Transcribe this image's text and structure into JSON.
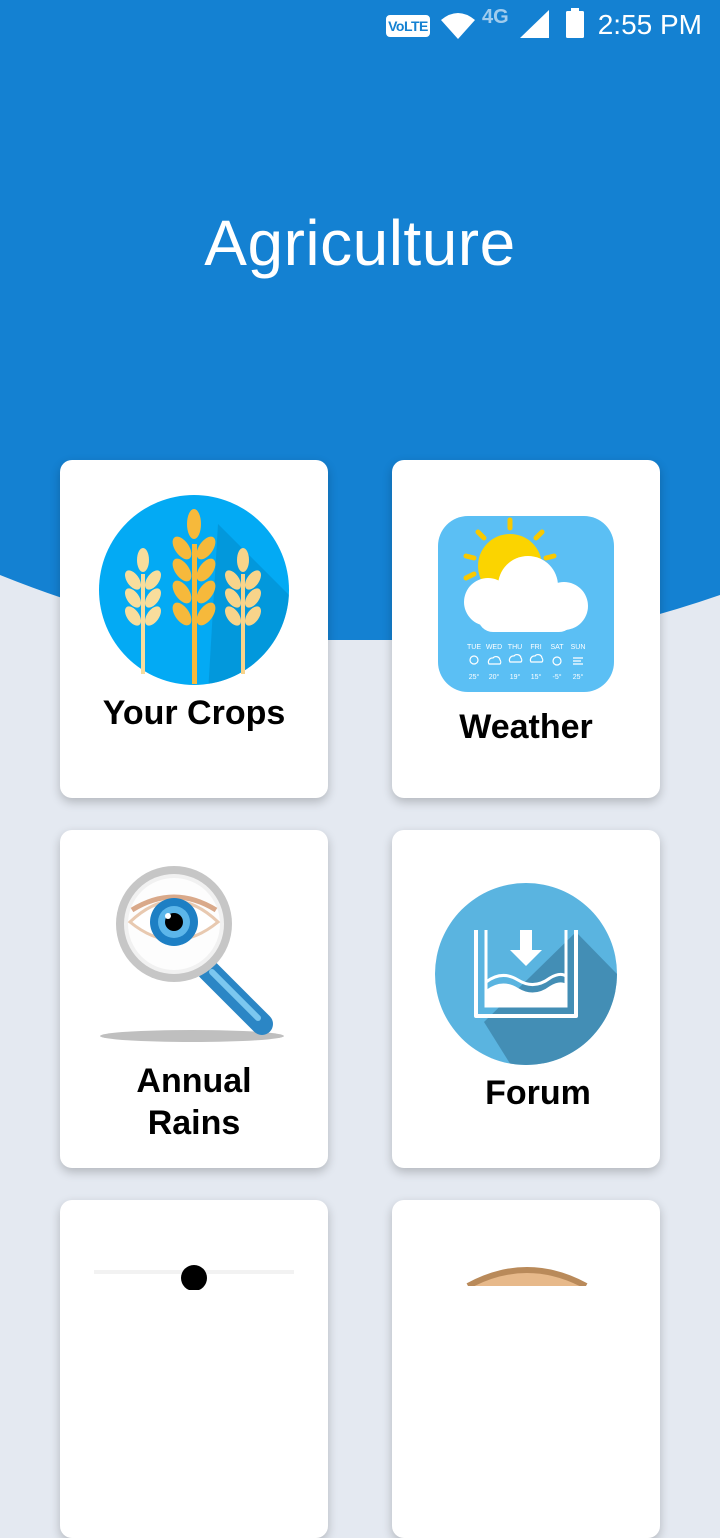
{
  "status_bar": {
    "network_badge": "VoLTE",
    "network_type": "4G",
    "time": "2:55 PM"
  },
  "header": {
    "title": "Agriculture",
    "color": "#1481d2"
  },
  "cards": [
    {
      "label": "Your Crops",
      "icon": "wheat-icon"
    },
    {
      "label": "Weather",
      "icon": "weather-app-icon"
    },
    {
      "label_line1": "Annual",
      "label_line2": "Rains",
      "icon": "magnifier-eye-icon"
    },
    {
      "label": "Forum",
      "icon": "water-tank-download-icon"
    },
    {
      "icon": "person-icon"
    },
    {
      "icon": "face-icon"
    }
  ],
  "weather_icon": {
    "days": [
      "TUE",
      "WED",
      "THU",
      "FRI",
      "SAT",
      "SUN"
    ],
    "temps": [
      "25°",
      "20°",
      "19°",
      "15°",
      "-5°",
      "25°"
    ]
  }
}
